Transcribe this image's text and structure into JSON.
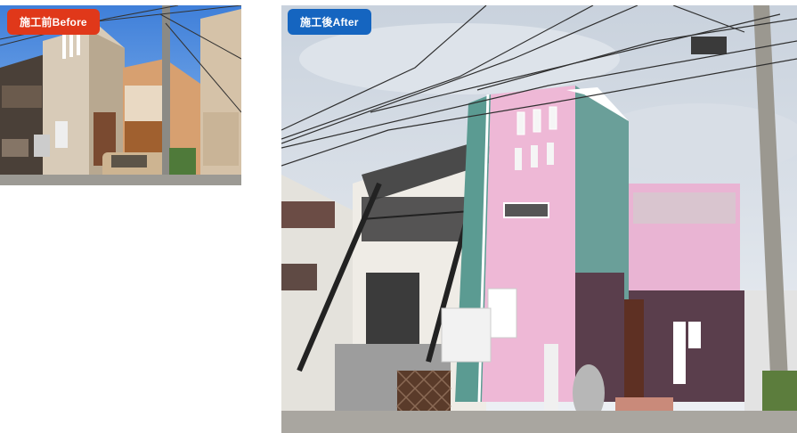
{
  "before": {
    "badge_label": "施工前Before",
    "badge_color": "#e0381a"
  },
  "after": {
    "badge_label": "施工後After",
    "badge_color": "#1565c0"
  }
}
